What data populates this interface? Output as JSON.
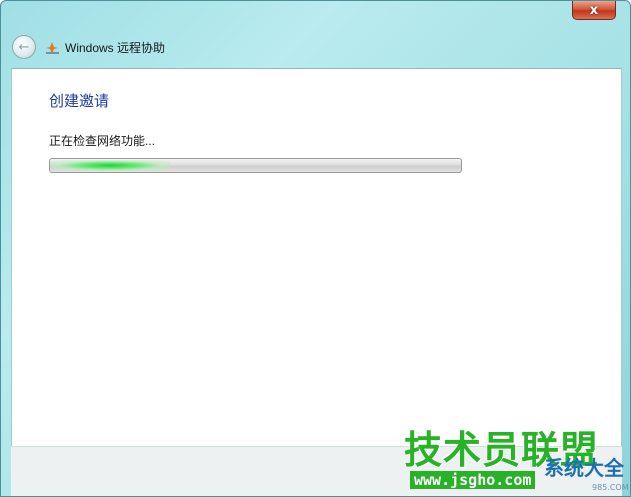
{
  "window": {
    "close_symbol": "x"
  },
  "navbar": {
    "back_symbol": "←",
    "title": "Windows 远程协助"
  },
  "content": {
    "heading": "创建邀请",
    "status_text": "正在检查网络功能..."
  },
  "progress": {
    "indeterminate": true
  },
  "watermark": {
    "main": "技术员联盟",
    "url": "www.jsgho.com",
    "side": "系统大全",
    "side_small": "985.COM"
  },
  "icons": {
    "close": "close-icon",
    "back": "back-arrow-icon",
    "app": "remote-assistance-icon"
  },
  "colors": {
    "heading": "#1e3d9e",
    "progress_glow": "#1dd339",
    "close_button": "#c2361d",
    "watermark_green": "#27b227"
  }
}
